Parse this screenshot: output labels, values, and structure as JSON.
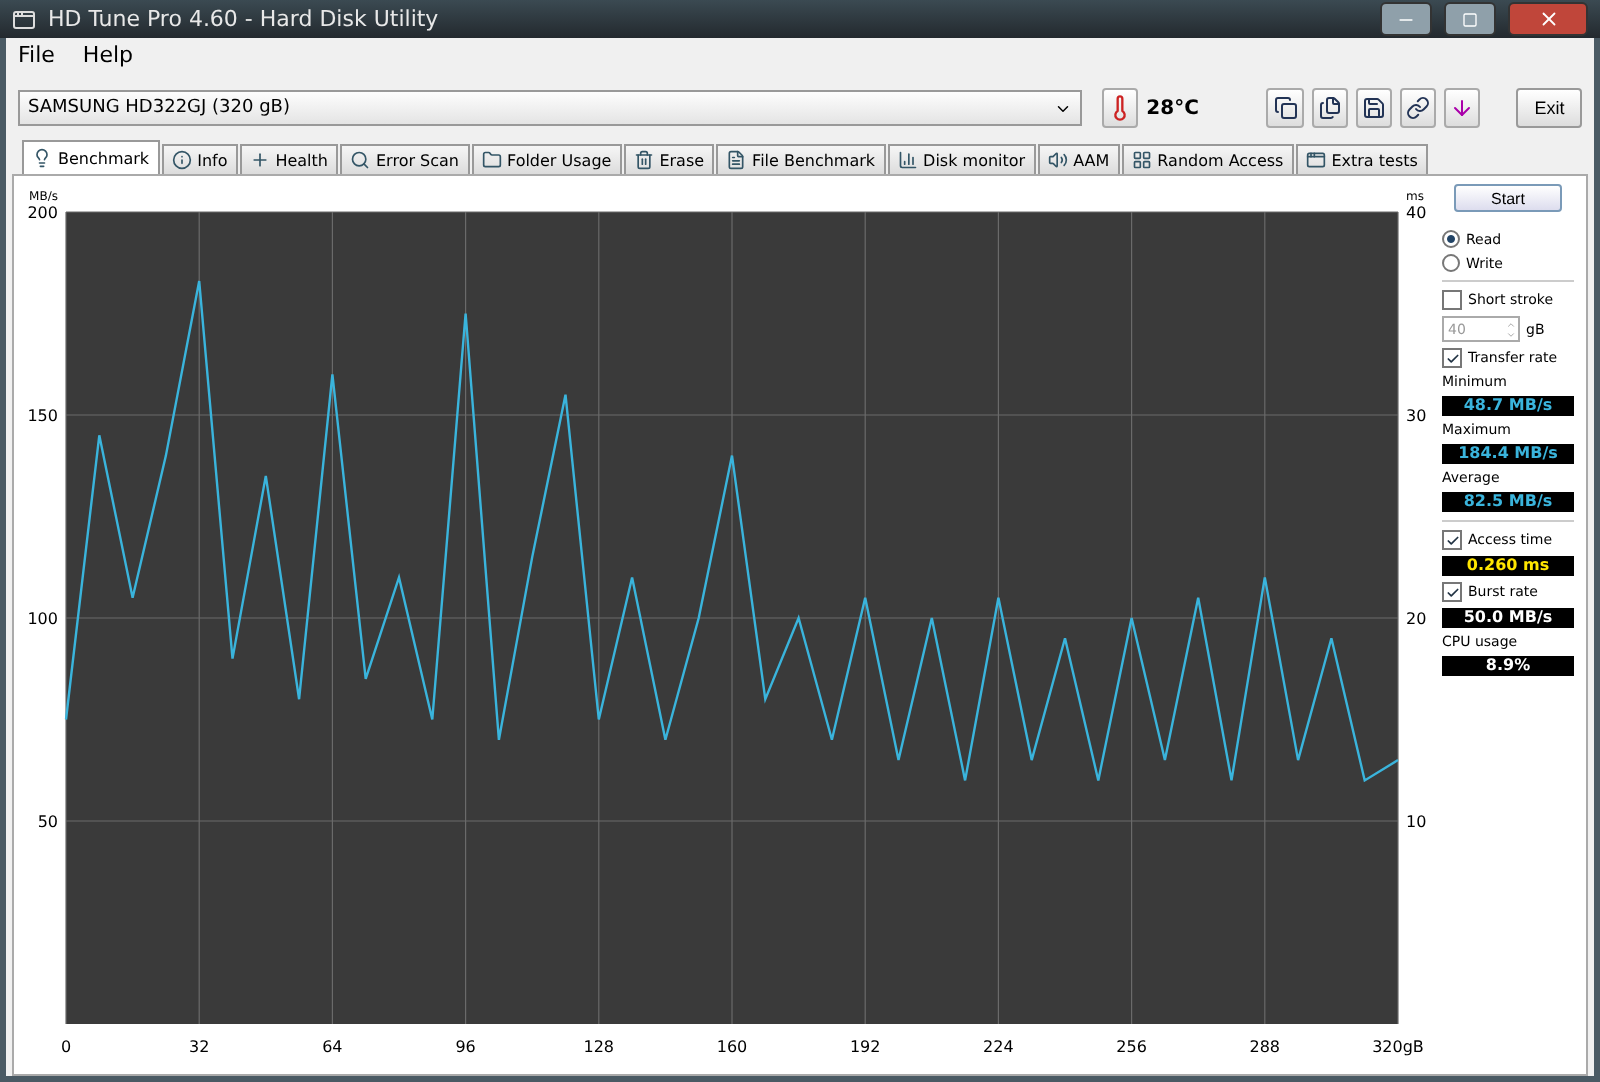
{
  "window": {
    "title": "HD Tune Pro 4.60 - Hard Disk Utility"
  },
  "menu": [
    "File",
    "Help"
  ],
  "drive": {
    "value": "SAMSUNG HD322GJ (320 gB)"
  },
  "temperature": "28°C",
  "exit": "Exit",
  "tabs": [
    {
      "label": "Benchmark",
      "selected": true
    },
    {
      "label": "Info",
      "selected": false
    },
    {
      "label": "Health",
      "selected": false
    },
    {
      "label": "Error Scan",
      "selected": false
    },
    {
      "label": "Folder Usage",
      "selected": false
    },
    {
      "label": "Erase",
      "selected": false
    },
    {
      "label": "File Benchmark",
      "selected": false
    },
    {
      "label": "Disk monitor",
      "selected": false
    },
    {
      "label": "AAM",
      "selected": false
    },
    {
      "label": "Random Access",
      "selected": false
    },
    {
      "label": "Extra tests",
      "selected": false
    }
  ],
  "chart": {
    "y_unit": "MB/s",
    "y2_unit": "ms",
    "y2_ticks": [
      "40",
      "30",
      "20",
      "10"
    ],
    "chart_data": {
      "type": "line",
      "grid": true,
      "xlim": [
        0,
        320
      ],
      "ylim": [
        0,
        200
      ],
      "xticks": [
        0,
        32,
        64,
        96,
        128,
        160,
        192,
        224,
        256,
        288,
        {
          "value": 320,
          "label": "320gB"
        }
      ],
      "yticks": [
        50,
        100,
        150,
        200
      ],
      "x": [
        0,
        8,
        16,
        24,
        32,
        40,
        48,
        56,
        64,
        72,
        80,
        88,
        96,
        104,
        112,
        120,
        128,
        136,
        144,
        152,
        160,
        168,
        176,
        184,
        192,
        200,
        208,
        216,
        224,
        232,
        240,
        248,
        256,
        264,
        272,
        280,
        288,
        296,
        304,
        312,
        320
      ],
      "series": [
        {
          "color": "#3ab4dc",
          "values": [
            75,
            145,
            105,
            140,
            183,
            90,
            135,
            80,
            160,
            85,
            110,
            75,
            175,
            70,
            115,
            155,
            75,
            110,
            70,
            100,
            140,
            80,
            100,
            70,
            105,
            65,
            100,
            60,
            105,
            65,
            95,
            60,
            100,
            65,
            105,
            60,
            110,
            65,
            95,
            60,
            65
          ]
        }
      ]
    }
  },
  "panel": {
    "start": "Start",
    "modes": [
      {
        "label": "Read",
        "selected": true
      },
      {
        "label": "Write",
        "selected": false
      }
    ],
    "short_stroke": {
      "label": "Short stroke",
      "checked": false
    },
    "stroke_value": "40",
    "stroke_unit": "gB",
    "transfer_rate": {
      "label": "Transfer rate",
      "checked": true
    },
    "stats": [
      {
        "label": "Minimum",
        "value": "48.7 MB/s"
      },
      {
        "label": "Maximum",
        "value": "184.4 MB/s"
      },
      {
        "label": "Average",
        "value": "82.5 MB/s"
      }
    ],
    "access_time": {
      "label": "Access time",
      "checked": true,
      "value": "0.260 ms"
    },
    "burst_rate": {
      "label": "Burst rate",
      "checked": true,
      "value": "50.0 MB/s"
    },
    "cpu": {
      "label": "CPU usage",
      "value": "8.9%"
    }
  }
}
